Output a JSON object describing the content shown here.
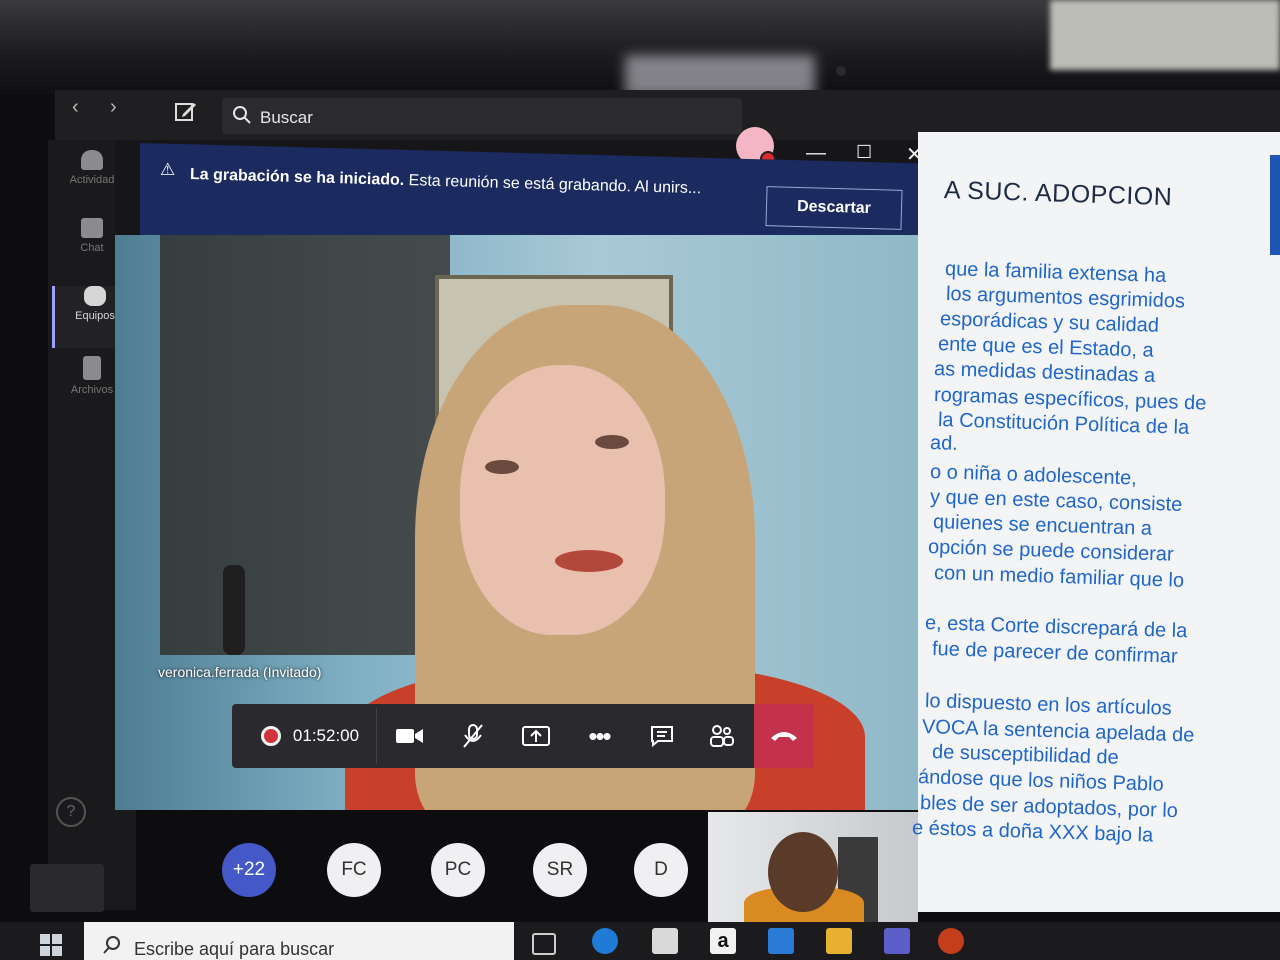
{
  "teams": {
    "search_placeholder": "Buscar",
    "rail": [
      {
        "label": "Actividad",
        "icon": "bell-icon"
      },
      {
        "label": "Chat",
        "icon": "chat-icon"
      },
      {
        "label": "Equipos",
        "icon": "teams-icon"
      },
      {
        "label": "Archivos",
        "icon": "file-icon"
      }
    ]
  },
  "banner": {
    "bold": "La grabación se ha iniciado.",
    "text": "Esta reunión se está grabando. Al unirs...",
    "dismiss": "Descartar"
  },
  "video": {
    "participant_name": "veronica.ferrada (Invitado)"
  },
  "call_controls": {
    "timer": "01:52:00"
  },
  "participants": [
    {
      "initials": "+22"
    },
    {
      "initials": "FC"
    },
    {
      "initials": "PC"
    },
    {
      "initials": "SR"
    },
    {
      "initials": "D"
    }
  ],
  "document": {
    "title": "A SUC. ADOPCION",
    "lines": [
      "que la familia extensa ha",
      "los argumentos esgrimidos",
      "esporádicas y su calidad",
      "ente que es el Estado, a",
      "as medidas destinadas a",
      "rogramas específicos, pues de",
      "la Constitución Política de la",
      "ad.",
      "o o niña o adolescente,",
      "y que en este caso, consiste",
      "quienes se encuentran a",
      "opción se puede considerar",
      "con un medio familiar que lo",
      "e, esta Corte discrepará de la",
      "fue de parecer de confirmar",
      "lo dispuesto en los artículos",
      "VOCA la sentencia apelada de",
      "de susceptibilidad de",
      "ándose que los niños Pablo",
      "bles de ser adoptados, por lo",
      "e éstos a doña XXX bajo la"
    ]
  },
  "taskbar": {
    "search_placeholder": "Escribe aquí para buscar"
  },
  "colors": {
    "banner_bg": "#1b2a5f",
    "hangup": "#c4314b",
    "recording": "#d13438",
    "doc_text": "#1f66c8",
    "more_participants": "#4458c8"
  }
}
